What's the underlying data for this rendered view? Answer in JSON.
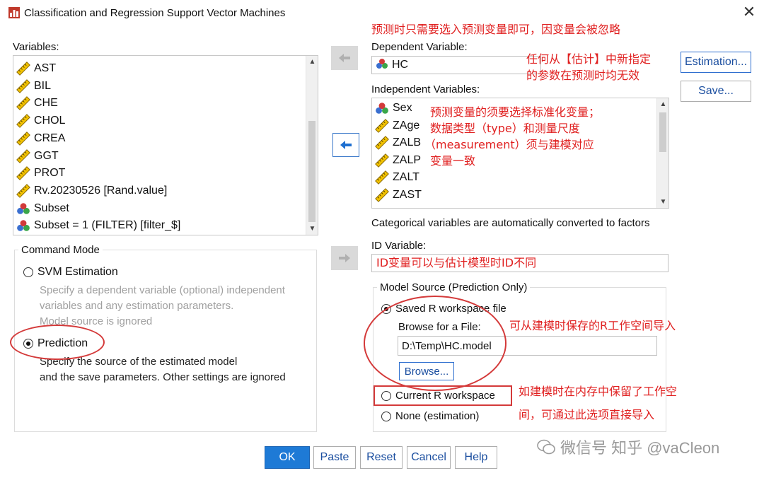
{
  "window": {
    "title": "Classification and Regression Support Vector Machines",
    "close_glyph": "✕"
  },
  "variables": {
    "label": "Variables:",
    "items": [
      {
        "label": "AST",
        "icon": "ruler-icon"
      },
      {
        "label": "BIL",
        "icon": "ruler-icon"
      },
      {
        "label": "CHE",
        "icon": "ruler-icon"
      },
      {
        "label": "CHOL",
        "icon": "ruler-icon"
      },
      {
        "label": "CREA",
        "icon": "ruler-icon"
      },
      {
        "label": "GGT",
        "icon": "ruler-icon"
      },
      {
        "label": "PROT",
        "icon": "ruler-icon"
      },
      {
        "label": "Rv.20230526 [Rand.value]",
        "icon": "ruler-icon"
      },
      {
        "label": "Subset",
        "icon": "nominal-balls-icon"
      },
      {
        "label": "Subset = 1 (FILTER) [filter_$]",
        "icon": "nominal-balls-icon"
      }
    ]
  },
  "dependent": {
    "label": "Dependent Variable:",
    "value": "HC"
  },
  "independent": {
    "label": "Independent Variables:",
    "items": [
      {
        "label": "Sex",
        "icon": "nominal-balls-icon"
      },
      {
        "label": "ZAge",
        "icon": "ruler-icon"
      },
      {
        "label": "ZALB",
        "icon": "ruler-icon"
      },
      {
        "label": "ZALP",
        "icon": "ruler-icon"
      },
      {
        "label": "ZALT",
        "icon": "ruler-icon"
      },
      {
        "label": "ZAST",
        "icon": "ruler-icon"
      }
    ]
  },
  "categorical_note": "Categorical variables are automatically converted to factors",
  "id_variable": {
    "label": "ID Variable:"
  },
  "side_buttons": {
    "estimation": "Estimation...",
    "save": "Save..."
  },
  "command_mode": {
    "title": "Command Mode",
    "svm_label": "SVM Estimation",
    "svm_desc": [
      "Specify a dependent variable (optional) independent",
      "variables and any estimation parameters.",
      "Model source is ignored"
    ],
    "prediction_label": "Prediction",
    "prediction_desc": [
      "Specify the source of the estimated model",
      "and the save parameters.  Other settings are ignored"
    ],
    "selected": "Prediction"
  },
  "model_source": {
    "title": "Model Source (Prediction Only)",
    "saved_label": "Saved R workspace file",
    "browse_label": "Browse for a File:",
    "file_value": "D:\\Temp\\HC.model",
    "browse_button": "Browse...",
    "current_label": "Current R workspace",
    "none_label": "None (estimation)",
    "selected": "Saved R workspace file"
  },
  "footer": {
    "ok": "OK",
    "paste": "Paste",
    "reset": "Reset",
    "cancel": "Cancel",
    "help": "Help"
  },
  "annotations": {
    "top": "预测时只需要选入预测变量即可，因变量会被忽略",
    "estimation_1": "任何从【估计】中新指定",
    "estimation_2": "的参数在预测时均无效",
    "indep_1": "预测变量的须要选择标准化变量；",
    "indep_2": "数据类型（type）和测量尺度",
    "indep_3": "（measurement）须与建模对应",
    "indep_4": "变量一致",
    "id": "ID变量可以与估计模型时ID不同",
    "file": "可从建模时保存的R工作空间导入",
    "current_1": "如建模时在内存中保留了工作空",
    "current_2": "间，可通过此选项直接导入"
  },
  "watermark": "微信号 知乎 @vaCleon",
  "colors": {
    "accent": "#1e7ad6",
    "annotation": "#e02020"
  }
}
